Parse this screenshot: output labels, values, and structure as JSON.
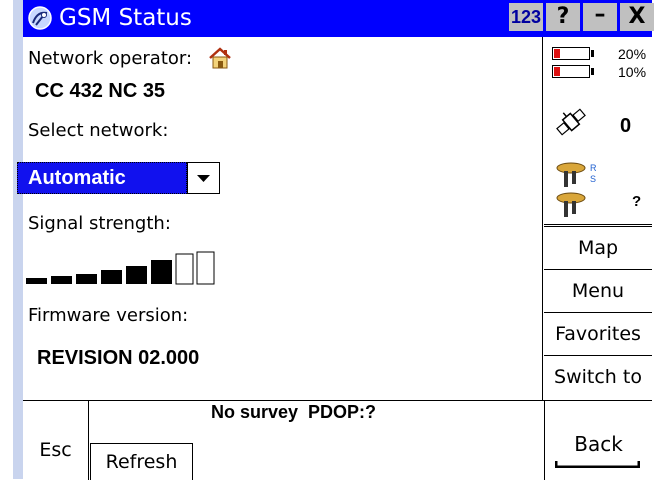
{
  "window": {
    "title": "GSM Status",
    "input_mode": "123",
    "help_label": "?",
    "minimize_label": "–",
    "close_label": "X"
  },
  "main": {
    "network_operator_label": "Network operator:",
    "network_operator_value": "CC 432 NC 35",
    "select_network_label": "Select network:",
    "select_network_value": "Automatic",
    "signal_strength_label": "Signal strength:",
    "signal_strength_bars_filled": 6,
    "signal_strength_bars_total": 8,
    "firmware_label": "Firmware version:",
    "firmware_value": "REVISION 02.000"
  },
  "status_panel": {
    "battery_1_percent": "20%",
    "battery_2_percent": "10%",
    "satellite_count": "0",
    "rover_status": "?",
    "radio_letters": [
      "R",
      "S"
    ]
  },
  "side_buttons": {
    "map": "Map",
    "menu": "Menu",
    "favorites": "Favorites",
    "switch_to": "Switch to"
  },
  "bottom_bar": {
    "esc": "Esc",
    "refresh": "Refresh",
    "survey_status": "No survey  PDOP:?",
    "back": "Back"
  },
  "colors": {
    "title_bar": "#0000ff",
    "selection": "#1111ee",
    "battery_low": "#dd1111",
    "left_edge": "#c9d4ee"
  }
}
